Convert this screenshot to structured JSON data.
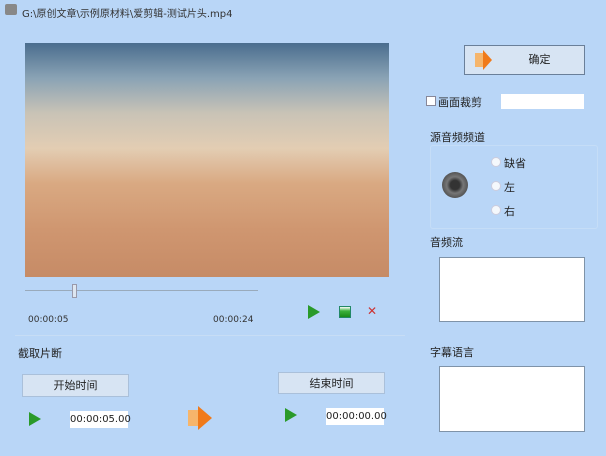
{
  "window": {
    "title": "G:\\原创文章\\示例原材料\\爱剪辑-测试片头.mp4"
  },
  "player": {
    "current_time": "00:00:05",
    "total_time": "00:00:24",
    "position_fraction": 0.21
  },
  "clip": {
    "section_label": "截取片断",
    "start_button": "开始时间",
    "end_button": "结束时间",
    "start_value": "00:00:05.00",
    "end_value": "00:00:00.00"
  },
  "right": {
    "confirm": "确定",
    "crop_label": "画面裁剪",
    "crop_value": "",
    "channel_label": "源音频频道",
    "channels": [
      "缺省",
      "左",
      "右"
    ],
    "audio_stream_label": "音频流",
    "subtitle_label": "字幕语言"
  }
}
